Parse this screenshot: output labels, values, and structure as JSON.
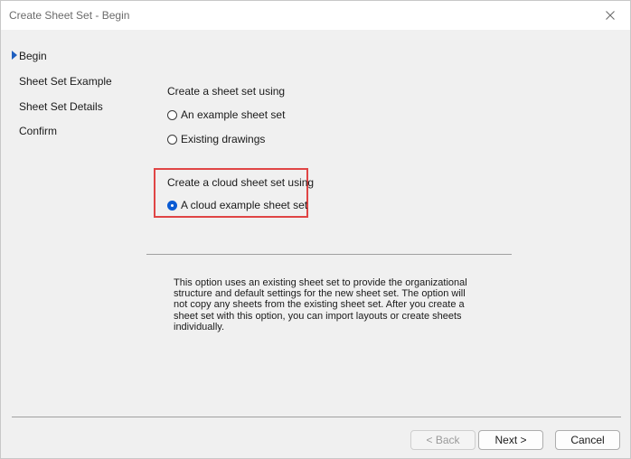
{
  "window": {
    "title": "Create Sheet Set - Begin",
    "close_icon": "close-icon"
  },
  "nav": {
    "active": "Begin",
    "items": [
      {
        "label": "Begin"
      },
      {
        "label": "Sheet Set Example"
      },
      {
        "label": "Sheet Set Details"
      },
      {
        "label": "Confirm"
      }
    ]
  },
  "main": {
    "create_using_label": "Create a sheet set using",
    "options": [
      {
        "label": "An example sheet set",
        "checked": false
      },
      {
        "label": "Existing drawings",
        "checked": false
      }
    ],
    "cloud_label": "Create a cloud sheet set using",
    "cloud_option": {
      "label": "A cloud example sheet set",
      "checked": true
    },
    "description": "This option uses an existing sheet set to provide the organizational structure and default settings for the new sheet set.  The option will not copy any sheets from the existing sheet set.  After you create a sheet set with this option, you can import layouts or create sheets individually."
  },
  "buttons": {
    "back": "< Back",
    "next": "Next >",
    "cancel": "Cancel"
  },
  "colors": {
    "accent": "#0a5bd3",
    "highlight": "#e04545"
  }
}
